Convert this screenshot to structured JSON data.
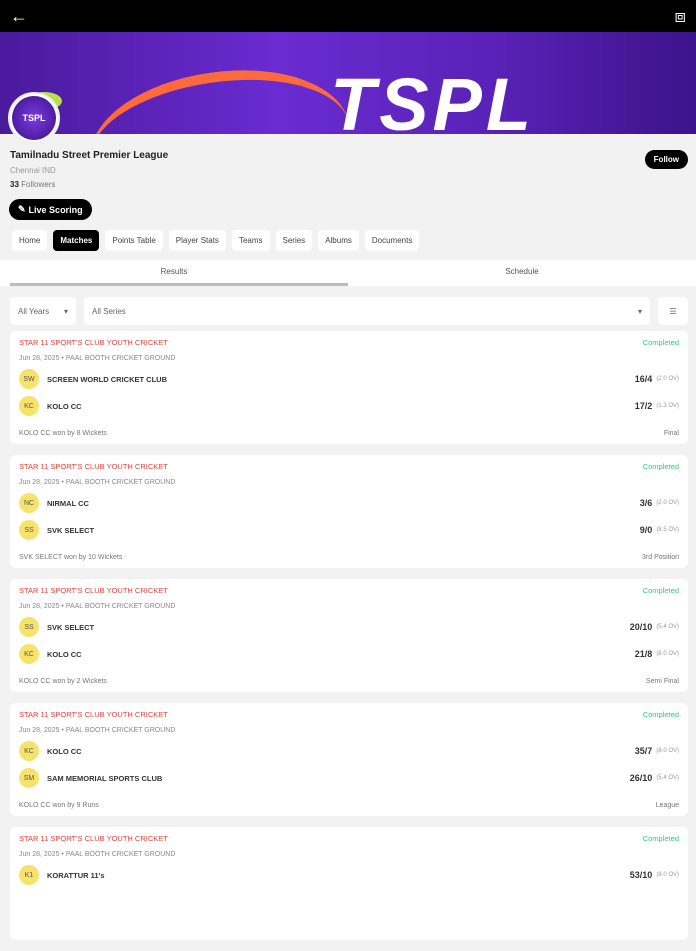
{
  "header": {
    "back_icon": "arrow-left",
    "share_icon": "share"
  },
  "banner": {
    "text": "TSPL",
    "logo_text": "TSPL"
  },
  "league": {
    "name": "Tamilnadu Street Premier League",
    "location": "Chennai IND",
    "followers_count": "33",
    "followers_label": "Followers",
    "follow_label": "Follow",
    "live_scoring_label": "Live Scoring"
  },
  "nav": [
    "Home",
    "Matches",
    "Points Table",
    "Player Stats",
    "Teams",
    "Series",
    "Albums",
    "Documents"
  ],
  "subtabs": [
    "Results",
    "Schedule"
  ],
  "filters": {
    "years": "All Years",
    "series": "All Series"
  },
  "matches": [
    {
      "series": "STAR 11 SPORT'S CLUB YOUTH CRICKET",
      "status": "Completed",
      "meta": "Jun 28, 2025 • PAAL BOOTH CRICKET GROUND",
      "teams": [
        {
          "abbr": "SW",
          "name": "SCREEN WORLD CRICKET CLUB",
          "score": "16/4",
          "overs": "(2.0 OV)"
        },
        {
          "abbr": "KC",
          "name": "KOLO CC",
          "score": "17/2",
          "overs": "(1.3 OV)"
        }
      ],
      "result": "KOLO CC won by 8 Wickets",
      "stage": "Final"
    },
    {
      "series": "STAR 11 SPORT'S CLUB YOUTH CRICKET",
      "status": "Completed",
      "meta": "Jun 28, 2025 • PAAL BOOTH CRICKET GROUND",
      "teams": [
        {
          "abbr": "NC",
          "name": "NIRMAL CC",
          "score": "3/6",
          "overs": "(2.0 OV)"
        },
        {
          "abbr": "SS",
          "name": "SVK SELECT",
          "score": "9/0",
          "overs": "(8.5 OV)"
        }
      ],
      "result": "SVK SELECT won by 10 Wickets",
      "stage": "3rd Position"
    },
    {
      "series": "STAR 11 SPORT'S CLUB YOUTH CRICKET",
      "status": "Completed",
      "meta": "Jun 28, 2025 • PAAL BOOTH CRICKET GROUND",
      "teams": [
        {
          "abbr": "SS",
          "name": "SVK SELECT",
          "score": "20/10",
          "overs": "(5.4 OV)"
        },
        {
          "abbr": "KC",
          "name": "KOLO CC",
          "score": "21/8",
          "overs": "(8.0 OV)"
        }
      ],
      "result": "KOLO CC won by 2 Wickets",
      "stage": "Semi Final"
    },
    {
      "series": "STAR 11 SPORT'S CLUB YOUTH CRICKET",
      "status": "Completed",
      "meta": "Jun 28, 2025 • PAAL BOOTH CRICKET GROUND",
      "teams": [
        {
          "abbr": "KC",
          "name": "KOLO CC",
          "score": "35/7",
          "overs": "(8.0 OV)"
        },
        {
          "abbr": "SM",
          "name": "SAM MEMORIAL SPORTS CLUB",
          "score": "26/10",
          "overs": "(5.4 OV)"
        }
      ],
      "result": "KOLO CC won by 9 Runs",
      "stage": "League"
    },
    {
      "series": "STAR 11 SPORT'S CLUB YOUTH CRICKET",
      "status": "Completed",
      "meta": "Jun 28, 2025 • PAAL BOOTH CRICKET GROUND",
      "teams": [
        {
          "abbr": "K1",
          "name": "KORATTUR 11's",
          "score": "53/10",
          "overs": "(8.0 OV)"
        }
      ]
    }
  ]
}
